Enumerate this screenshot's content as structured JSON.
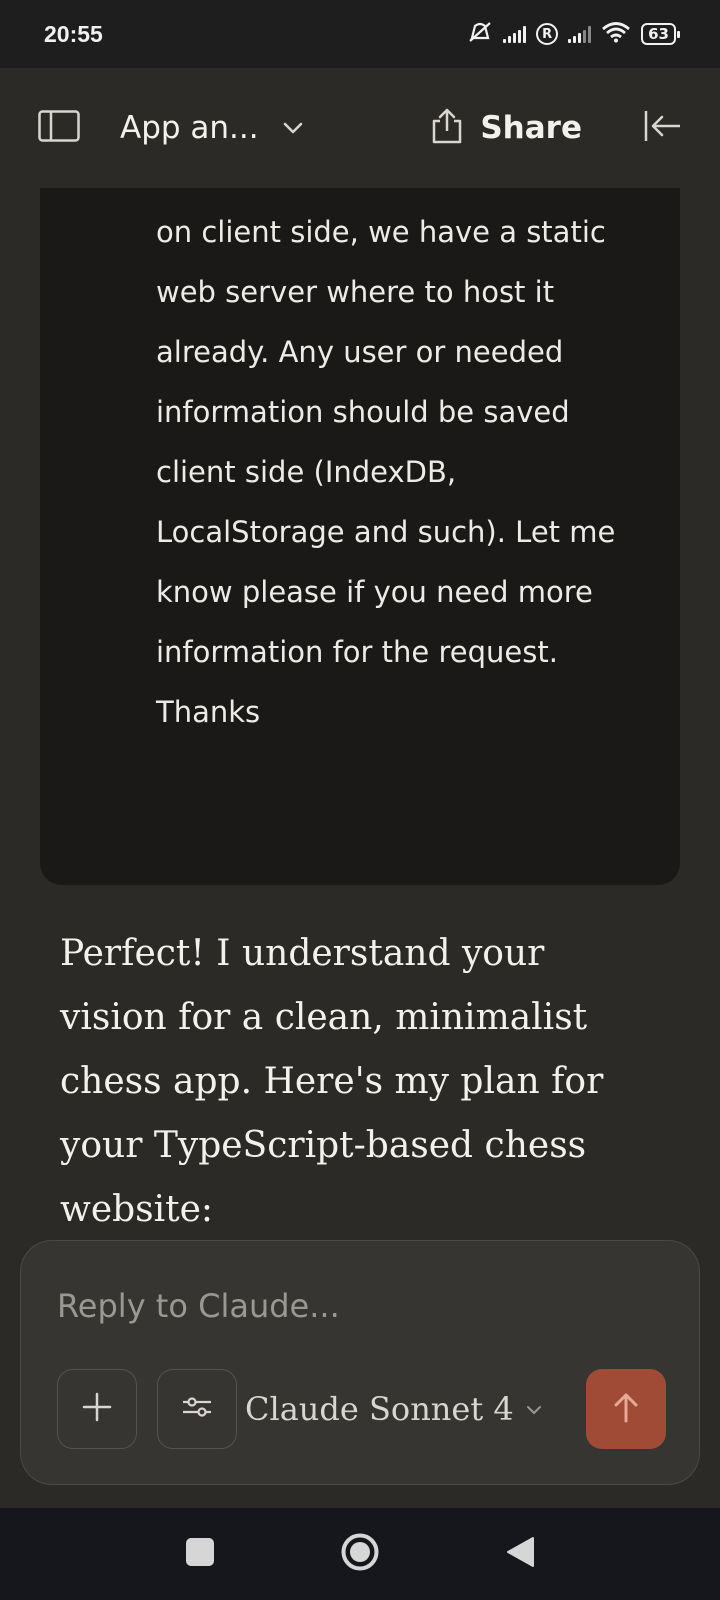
{
  "status_bar": {
    "time": "20:55",
    "sim_badge": "R",
    "battery": "63"
  },
  "header": {
    "title": "App an...",
    "share_label": "Share"
  },
  "conversation": {
    "user_message": "on client side, we have a static web server where to host it already. Any user or needed information should be saved client side (IndexDB, LocalStorage and such). Let me know please if you need more information for the request. Thanks",
    "assistant_message": "Perfect! I understand your vision for a clean, minimalist chess app. Here's my plan for your TypeScript-based chess website:"
  },
  "composer": {
    "placeholder": "Reply to Claude...",
    "model": "Claude Sonnet 4"
  },
  "icons": {
    "sidebar": "sidebar-icon",
    "chevron": "chevron-down-icon",
    "share": "share-icon",
    "collapse": "collapse-left-icon",
    "plus": "plus-icon",
    "tools": "sliders-icon",
    "send": "arrow-up-icon",
    "nav_recents": "square-icon",
    "nav_home": "circle-icon",
    "nav_back": "triangle-back-icon"
  },
  "colors": {
    "background": "#2b2a27",
    "user_bubble": "#1a1918",
    "composer": "#363532",
    "send_accent": "#9f4b35",
    "nav_bar": "#16171c"
  }
}
